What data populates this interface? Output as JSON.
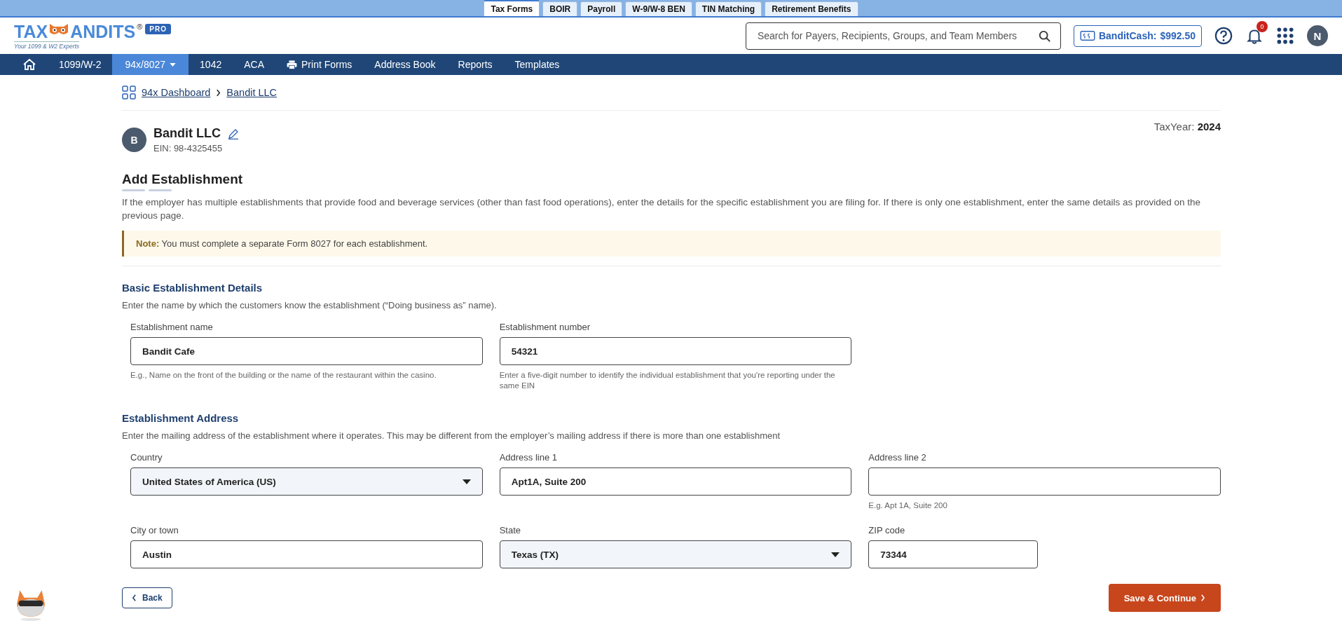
{
  "top_tabs": [
    {
      "label": "Tax Forms",
      "selected": true
    },
    {
      "label": "BOIR",
      "selected": false
    },
    {
      "label": "Payroll",
      "selected": false
    },
    {
      "label": "W-9/W-8 BEN",
      "selected": false
    },
    {
      "label": "TIN Matching",
      "selected": false
    },
    {
      "label": "Retirement Benefits",
      "selected": false
    }
  ],
  "header": {
    "logo": {
      "word_left": "TAX",
      "word_right": "ANDITS",
      "registered": "®",
      "tagline": "Your 1099 & W2 Experts",
      "badge": "PRO"
    },
    "search": {
      "placeholder": "Search for Payers, Recipients, Groups, and Team Members"
    },
    "cash": {
      "label": "BanditCash:",
      "amount": "$992.50"
    },
    "notifications": {
      "count": "0"
    },
    "avatar": "N"
  },
  "nav": [
    {
      "kind": "home",
      "selected": false
    },
    {
      "kind": "text",
      "label": "1099/W-2",
      "selected": false
    },
    {
      "kind": "dropdown",
      "label": "94x/8027",
      "selected": true
    },
    {
      "kind": "text",
      "label": "1042",
      "selected": false
    },
    {
      "kind": "text",
      "label": "ACA",
      "selected": false
    },
    {
      "kind": "print",
      "label": "Print Forms",
      "selected": false
    },
    {
      "kind": "text",
      "label": "Address Book",
      "selected": false
    },
    {
      "kind": "text",
      "label": "Reports",
      "selected": false
    },
    {
      "kind": "text",
      "label": "Templates",
      "selected": false
    }
  ],
  "breadcrumb": [
    "94x Dashboard",
    "Bandit LLC"
  ],
  "business": {
    "avatar": "B",
    "name": "Bandit LLC",
    "ein": "EIN: 98-4325455"
  },
  "tax_year": {
    "label": "TaxYear:",
    "value": "2024"
  },
  "title": "Add Establishment",
  "intro": "If the employer has multiple establishments that provide food and beverage services (other than fast food operations), enter the details for the specific establishment you are filing for. If there is only one establishment, enter the same details as provided on the previous page.",
  "note": {
    "label": "Note:",
    "text": "You must complete a separate Form 8027 for each establishment."
  },
  "sections": [
    {
      "heading": "Basic Establishment Details",
      "description": "Enter the name by which the customers know the establishment (“Doing business as” name).",
      "fields": [
        {
          "kind": "text",
          "label": "Establishment name",
          "value": "Bandit Cafe",
          "hint": "E.g., Name on the front of the building or the name of the restaurant within the casino."
        },
        {
          "kind": "text",
          "label": "Establishment number",
          "value": "54321",
          "hint": "Enter a five-digit number to identify the individual establishment that you're reporting under the same EIN"
        }
      ]
    },
    {
      "heading": "Establishment Address",
      "description": "Enter the mailing address of the establishment where it operates. This may be different from the employer’s mailing address if there is more than one establishment",
      "fields": [
        {
          "kind": "select",
          "label": "Country",
          "value": "United States of America (US)"
        },
        {
          "kind": "text",
          "label": "Address line 1",
          "value": "Apt1A, Suite 200"
        },
        {
          "kind": "text",
          "label": "Address line 2",
          "hint": "E.g. Apt 1A, Suite 200"
        },
        {
          "kind": "text",
          "label": "City or town",
          "value": "Austin"
        },
        {
          "kind": "select",
          "label": "State",
          "value": "Texas (TX)"
        },
        {
          "kind": "short",
          "label": "ZIP code",
          "value": "73344"
        }
      ]
    }
  ],
  "buttons": {
    "back": "Back",
    "save": "Save & Continue"
  }
}
